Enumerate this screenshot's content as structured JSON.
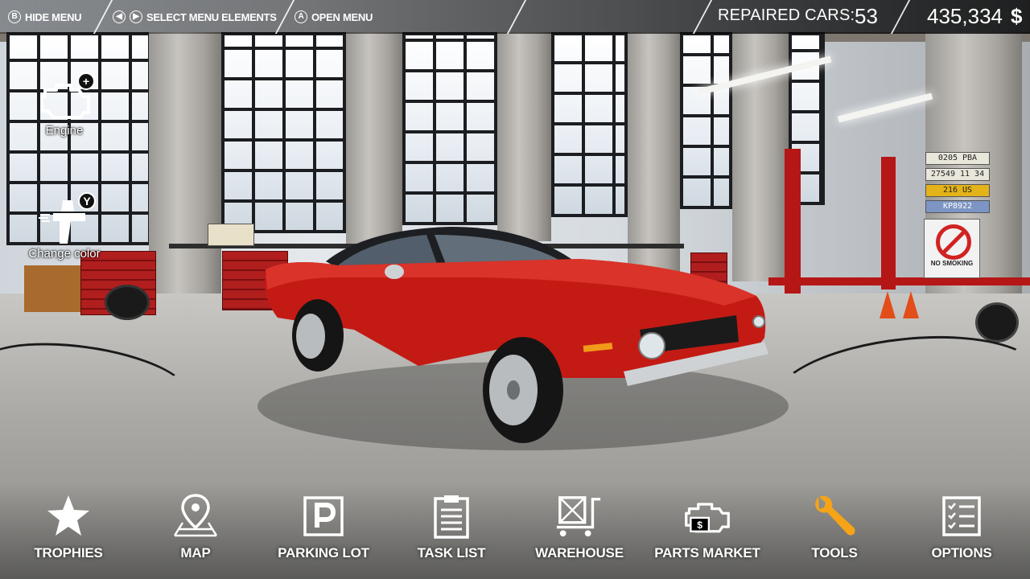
{
  "hud": {
    "hints": [
      {
        "button": "B",
        "label": "HIDE MENU"
      },
      {
        "button": "◀▶",
        "label": "SELECT MENU ELEMENTS"
      },
      {
        "button": "A",
        "label": "OPEN MENU"
      }
    ],
    "repaired_cars_label": "REPAIRED CARS:",
    "repaired_cars_value": "53",
    "money_value": "435,334",
    "currency_symbol": "$"
  },
  "quick_menu": [
    {
      "label": "Engine",
      "badge": "+",
      "icon": "engine-icon"
    },
    {
      "label": "Change color",
      "badge": "Y",
      "icon": "spray-gun-icon"
    }
  ],
  "scene_text": {
    "plates": [
      "0205 PBA",
      "27549 11 34",
      "216 US",
      "KP8922"
    ],
    "sign": "NO SMOKING"
  },
  "bottom_menu": [
    {
      "label": "TROPHIES",
      "icon": "star-icon"
    },
    {
      "label": "MAP",
      "icon": "map-pin-icon"
    },
    {
      "label": "PARKING LOT",
      "icon": "parking-icon"
    },
    {
      "label": "TASK LIST",
      "icon": "clipboard-icon"
    },
    {
      "label": "WAREHOUSE",
      "icon": "warehouse-cart-icon"
    },
    {
      "label": "PARTS MARKET",
      "icon": "parts-market-icon"
    },
    {
      "label": "TOOLS",
      "icon": "wrench-icon",
      "highlighted": true
    },
    {
      "label": "OPTIONS",
      "icon": "checklist-icon"
    }
  ],
  "colors": {
    "highlight": "#f5a418",
    "car": "#c41a14",
    "text": "#ffffff"
  }
}
